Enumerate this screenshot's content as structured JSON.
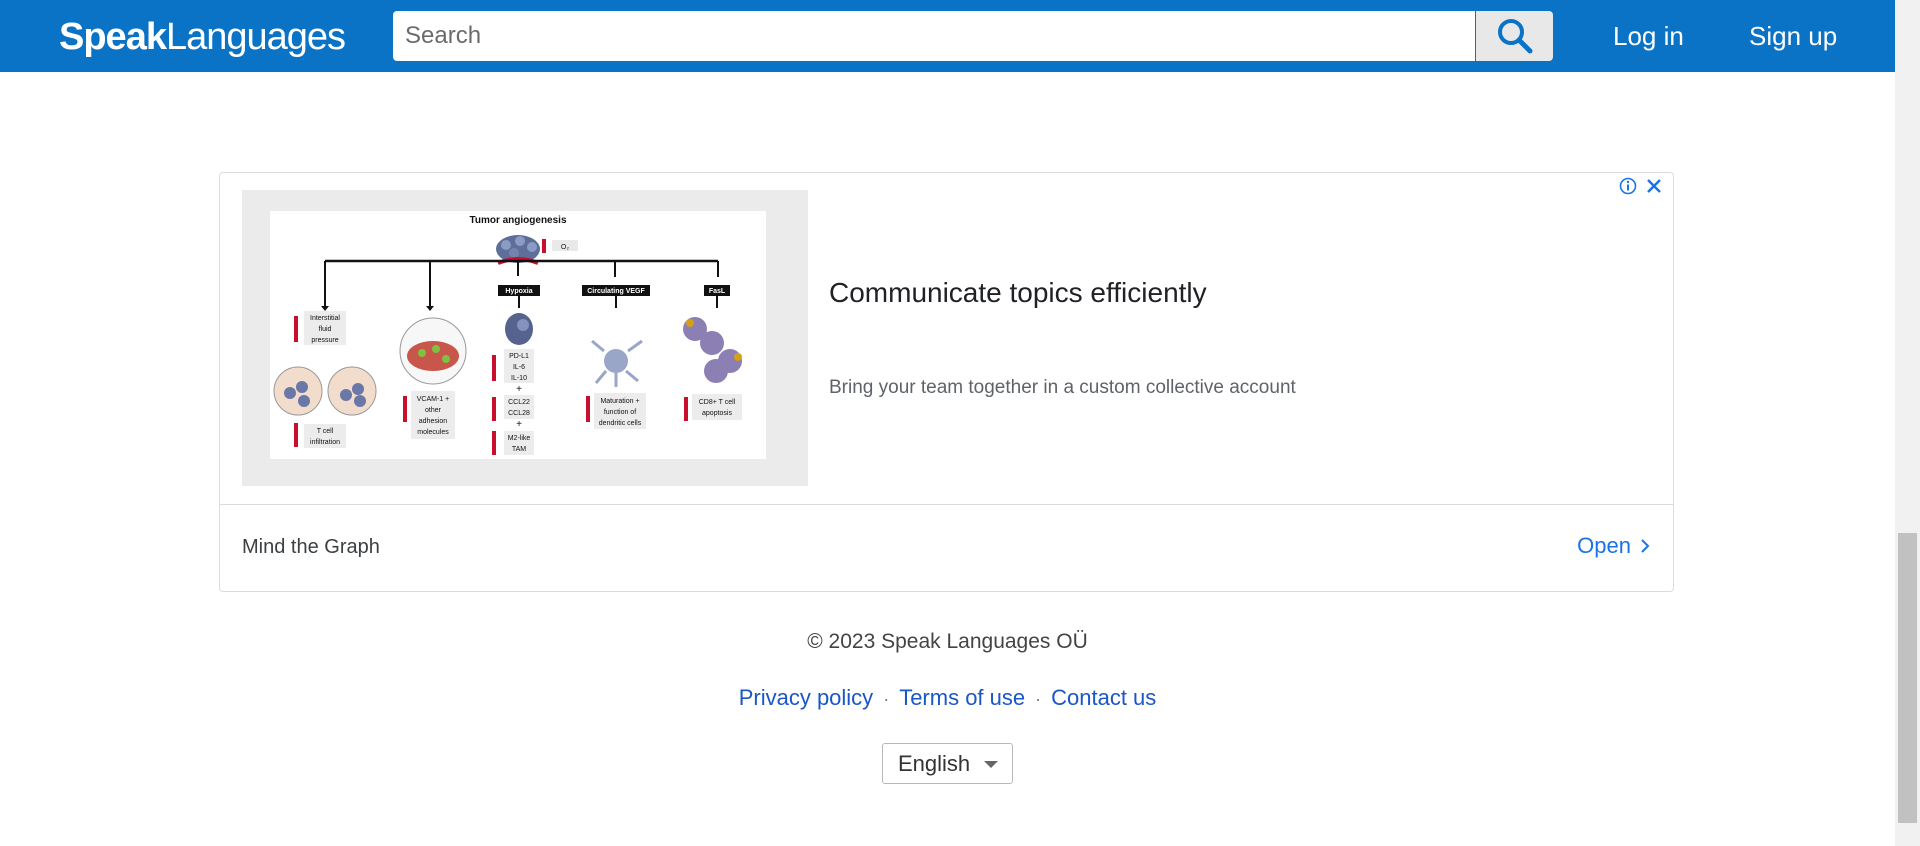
{
  "header": {
    "logo_bold": "Speak",
    "logo_light": "Languages",
    "search_placeholder": "Search",
    "login_label": "Log in",
    "signup_label": "Sign up",
    "accent_color": "#0a73c6"
  },
  "ad": {
    "image": {
      "title": "Tumor angiogenesis",
      "o2_label": "O₂",
      "hypoxia": "Hypoxia",
      "circulating_vegf": "Circulating VEGF",
      "fasl": "FasL",
      "interstitial_1": "Interstitial",
      "interstitial_2": "fluid",
      "interstitial_3": "pressure",
      "tcell_1": "T cell",
      "tcell_2": "infiltration",
      "vcam_1": "VCAM-1 +",
      "vcam_2": "other",
      "vcam_3": "adhesion",
      "vcam_4": "molecules",
      "pdl1": "PD-L1",
      "il6": "IL-6",
      "il10": "IL-10",
      "ccl22": "CCL22",
      "ccl28": "CCL28",
      "m2_1": "M2-like",
      "m2_2": "TAM",
      "mat_1": "Maturation +",
      "mat_2": "function of",
      "mat_3": "dendritic cells",
      "cd8_1": "CD8+ T cell",
      "cd8_2": "apoptosis"
    },
    "headline": "Communicate topics efficiently",
    "description": "Bring your team together in a custom collective account",
    "advertiser": "Mind the Graph",
    "open_label": "Open"
  },
  "footer": {
    "copyright": "© 2023 Speak Languages OÜ",
    "links": [
      "Privacy policy",
      "Terms of use",
      "Contact us"
    ],
    "separator": "·",
    "language": "English"
  }
}
